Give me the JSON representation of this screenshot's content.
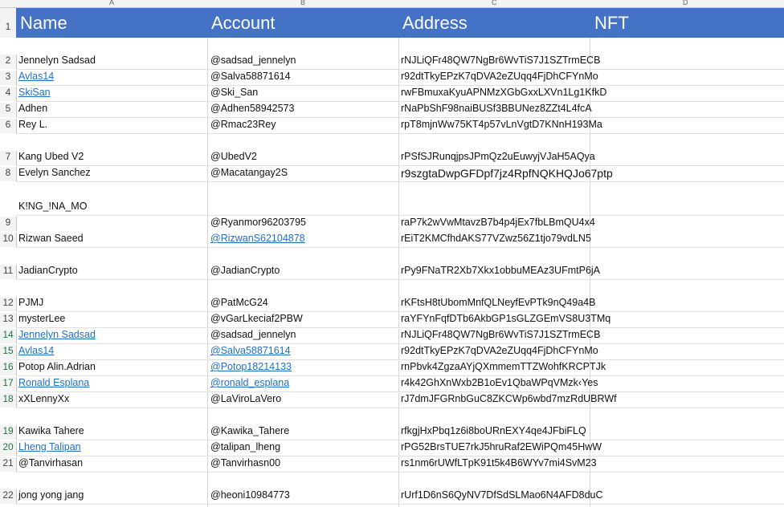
{
  "columns": {
    "a": "A",
    "b": "B",
    "c": "C",
    "d": "D"
  },
  "header": {
    "row_num": "1",
    "name": "Name",
    "account": "Account",
    "address": "Address",
    "nft": "NFT"
  },
  "rows": [
    {
      "num": "2",
      "name": "Jennelyn Sadsad",
      "account": "@sadsad_jennelyn",
      "address": "rNJLiQFr48QW7NgBr6WvTiS7J1SZTrmECB"
    },
    {
      "num": "3",
      "name": "Avlas14",
      "account": "@Salva58871614",
      "address": "r92dtTkyEPzK7qDVA2eZUqq4FjDhCFYnMo"
    },
    {
      "num": "4",
      "name": "SkiSan",
      "account": "@Ski_San",
      "address": "rwFBmuxaKyuAPNMzXGbGxxLXVn1Lg1KfkD"
    },
    {
      "num": "5",
      "name": "Adhen",
      "account": "@Adhen58942573",
      "address": "rNaPbShF98naiBUSf3BBUNez8ZZt4L4fcA"
    },
    {
      "num": "6",
      "name": "Rey L.",
      "account": "@Rmac23Rey",
      "address": "rpT8mjnWw75KT4p57vLnVgtD7KNnH193Ma"
    },
    {
      "num": "7",
      "name": "Kang Ubed V2",
      "account": "@UbedV2",
      "address": "rPSfSJRunqjpsJPmQz2uEuwyjVJaH5AQya"
    },
    {
      "num": "8",
      "name": "Evelyn Sanchez",
      "account": "@Macatangay2S",
      "address": "r9szgtaDwpGFDpf7jz4RpfNQKHQJo67ptp"
    },
    {
      "num": "9",
      "name": "K!NG_!NA_MO",
      "account": "@Ryanmor96203795",
      "address": "raP7k2wVwMtavzB7b4p4jEx7fbLBmQU4x4"
    },
    {
      "num": "10",
      "name": "Rizwan Saeed",
      "account": "@RizwanS62104878",
      "address": "rEiT2KMCfhdAKS77VZwz56Z1tjo79vdLN5"
    },
    {
      "num": "11",
      "name": "JadianCrypto",
      "account": "@JadianCrypto",
      "address": "rPy9FNaTR2Xb7Xkx1obbuMEAz3UFmtP6jA"
    },
    {
      "num": "12",
      "name": "PJMJ",
      "account": "@PatMcG24",
      "address": "rKFtsH8tUbomMnfQLNeyfEvPTk9nQ49a4B"
    },
    {
      "num": "13",
      "name": "mysterLee",
      "account": "@vGarLkeciaf2PBW",
      "address": "raYFYnFqfDTb6AkbGP1sGLZGEmVS8U3TMq"
    },
    {
      "num": "14",
      "name": "Jennelyn Sadsad",
      "account": "@sadsad_jennelyn",
      "address": "rNJLiQFr48QW7NgBr6WvTiS7J1SZTrmECB"
    },
    {
      "num": "15",
      "name": "Avlas14",
      "account": "@Salva58871614",
      "address": "r92dtTkyEPzK7qDVA2eZUqq4FjDhCFYnMo"
    },
    {
      "num": "16",
      "name": "Potop Alin.Adrian",
      "account": "@Potop18214133",
      "address": "rnPbvk4ZgzaAYjQXmmemTTZWohfKRCPTJk"
    },
    {
      "num": "17",
      "name": "Ronald Esplana",
      "account": "@ronald_esplana",
      "address": "r4k42GhXnWxb2B1oEv1QbaWPqVMzk‹Yes"
    },
    {
      "num": "18",
      "name": "xXLennyXx",
      "account": "@LaViroLaVero",
      "address": "rJ7dmJFGRnbGuC8ZKCWp6wbd7mzRdUBRWf"
    },
    {
      "num": "19",
      "name": "Kawika Tahere",
      "account": "@Kawika_Tahere",
      "address": "rfkgjHxPbq1z6i8boURnEXY4qe4JFbiFLQ"
    },
    {
      "num": "20",
      "name": "Lheng Talipan",
      "account": "@talipan_lheng",
      "address": "rPG52BrsTUE7rkJ5hruRaf2EWiPQm45HwW"
    },
    {
      "num": "21",
      "name": "@Tanvirhasan",
      "account": "@Tanvirhasn00",
      "address": "rs1nm6rUWfLTpK91t5k4B6WYv7mi4SvM23"
    },
    {
      "num": "22",
      "name": "jong yong jang",
      "account": "@heoni10984773",
      "address": "rUrf1D6nS6QyNV7DfSdSLMao6N4AFD8duC"
    }
  ]
}
